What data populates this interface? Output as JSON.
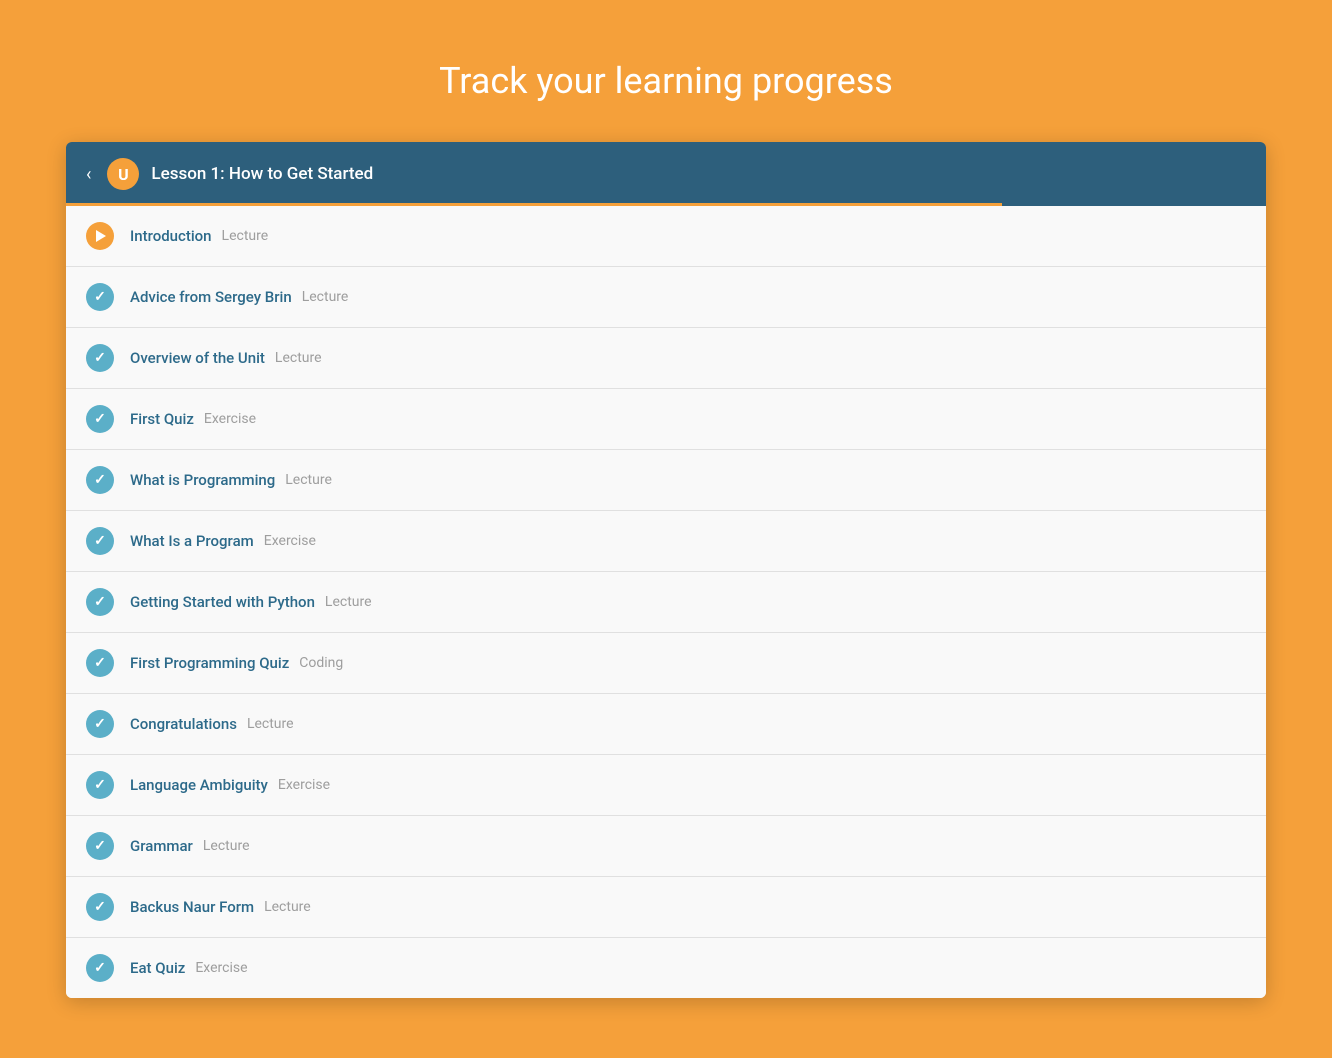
{
  "page": {
    "title": "Track your learning progress",
    "background_color": "#F5A03A"
  },
  "course": {
    "header_title": "Lesson 1: How to Get Started",
    "logo_letter": "U",
    "progress_percent": 78,
    "back_label": "‹"
  },
  "lessons": [
    {
      "id": 1,
      "name": "Introduction",
      "type": "Lecture",
      "status": "playing"
    },
    {
      "id": 2,
      "name": "Advice from Sergey Brin",
      "type": "Lecture",
      "status": "completed"
    },
    {
      "id": 3,
      "name": "Overview of the Unit",
      "type": "Lecture",
      "status": "completed"
    },
    {
      "id": 4,
      "name": "First Quiz",
      "type": "Exercise",
      "status": "completed"
    },
    {
      "id": 5,
      "name": "What is Programming",
      "type": "Lecture",
      "status": "completed"
    },
    {
      "id": 6,
      "name": "What Is a Program",
      "type": "Exercise",
      "status": "completed"
    },
    {
      "id": 7,
      "name": "Getting Started with Python",
      "type": "Lecture",
      "status": "completed"
    },
    {
      "id": 8,
      "name": "First Programming Quiz",
      "type": "Coding",
      "status": "completed"
    },
    {
      "id": 9,
      "name": "Congratulations",
      "type": "Lecture",
      "status": "completed"
    },
    {
      "id": 10,
      "name": "Language Ambiguity",
      "type": "Exercise",
      "status": "completed"
    },
    {
      "id": 11,
      "name": "Grammar",
      "type": "Lecture",
      "status": "completed"
    },
    {
      "id": 12,
      "name": "Backus Naur Form",
      "type": "Lecture",
      "status": "completed"
    },
    {
      "id": 13,
      "name": "Eat Quiz",
      "type": "Exercise",
      "status": "completed"
    }
  ]
}
